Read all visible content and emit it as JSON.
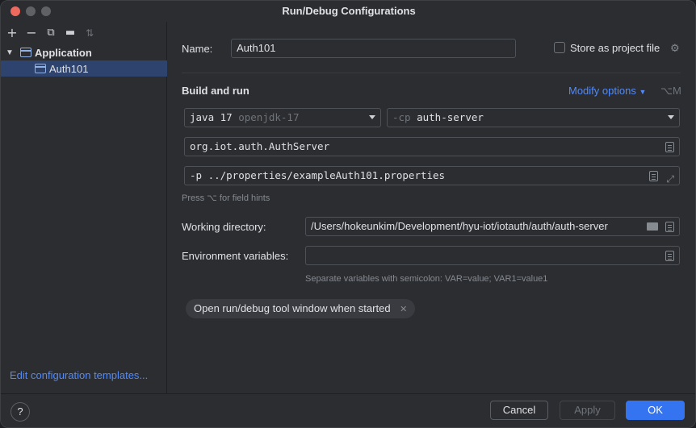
{
  "window": {
    "title": "Run/Debug Configurations"
  },
  "left": {
    "toolbar": {
      "add_icon": "plus-icon",
      "remove_icon": "minus-icon",
      "copy_icon": "copy-icon",
      "folder_icon": "new-folder-icon",
      "sort_icon": "sort-icon"
    },
    "tree": {
      "application_label": "Application",
      "auth_label": "Auth101"
    },
    "edit_templates_link": "Edit configuration templates..."
  },
  "form": {
    "name_label": "Name:",
    "name_value": "Auth101",
    "store_label": "Store as project file",
    "build_run_title": "Build and run",
    "modify_options": "Modify options",
    "modify_shortcut": "⌥M",
    "jdk_value": "java 17",
    "jdk_hint": "openjdk-17",
    "cp_prefix": "-cp",
    "cp_value": "auth-server",
    "main_class": "org.iot.auth.AuthServer",
    "program_args": "-p ../properties/exampleAuth101.properties",
    "field_hint": "Press ⌥ for field hints",
    "workdir_label": "Working directory:",
    "workdir_value": "/Users/hokeunkim/Development/hyu-iot/iotauth/auth/auth-server",
    "env_label": "Environment variables:",
    "env_value": "",
    "env_hint": "Separate variables with semicolon: VAR=value; VAR1=value1",
    "chip_label": "Open run/debug tool window when started"
  },
  "footer": {
    "help": "?",
    "cancel": "Cancel",
    "apply": "Apply",
    "ok": "OK"
  },
  "colors": {
    "accent": "#3574f0",
    "link": "#548af7",
    "selection": "#2e436e",
    "background": "#2b2d30"
  }
}
